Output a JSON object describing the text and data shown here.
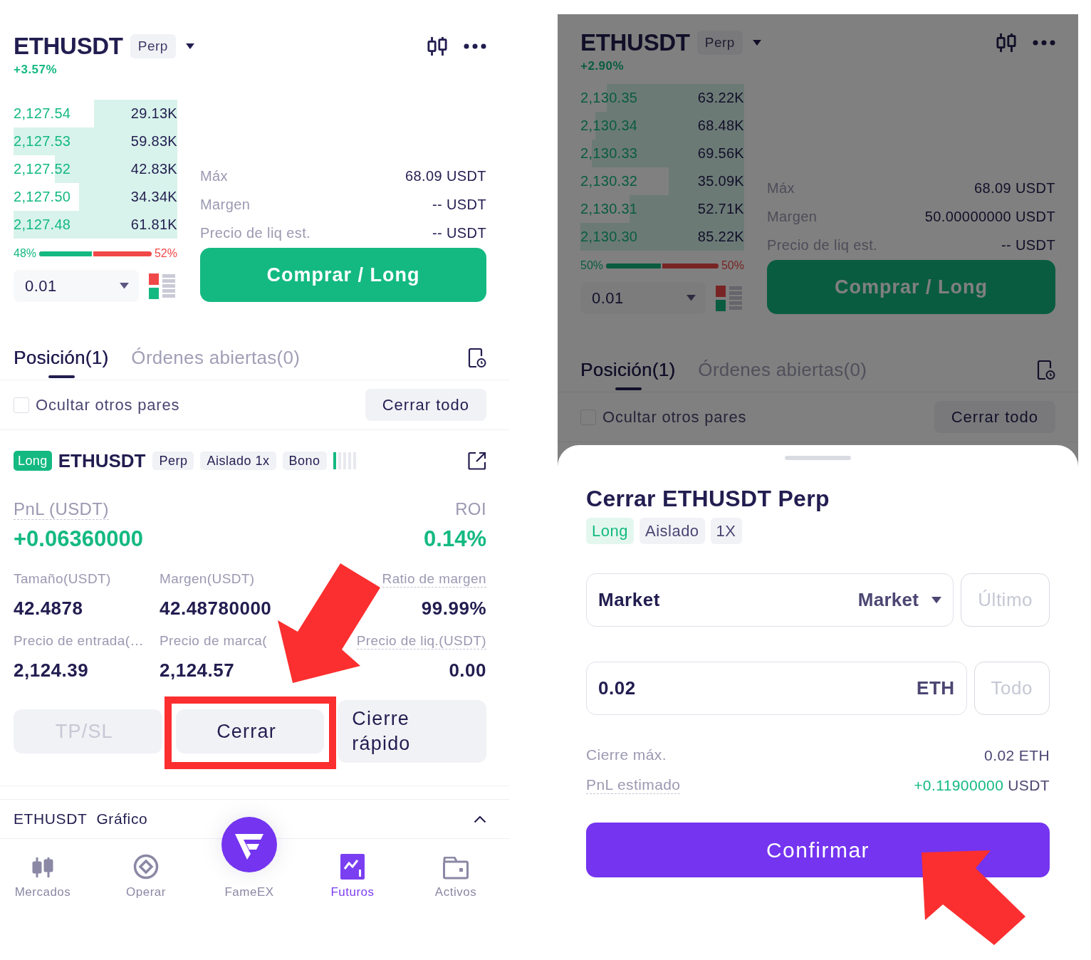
{
  "left_screen": {
    "header": {
      "symbol": "ETHUSDT",
      "chip": "Perp",
      "change": "+3.57%"
    },
    "order_book": [
      {
        "price": "2,127.54",
        "amount": "29.13K",
        "level": 0.51
      },
      {
        "price": "2,127.53",
        "amount": "59.83K",
        "level": 1
      },
      {
        "price": "2,127.52",
        "amount": "42.83K",
        "level": 0.75
      },
      {
        "price": "2,127.50",
        "amount": "34.34K",
        "level": 0.6
      },
      {
        "price": "2,127.48",
        "amount": "61.81K",
        "level": 1
      }
    ],
    "ratio": {
      "buy": "48%",
      "sell": "52%",
      "level": 0.48
    },
    "precision": "0.01",
    "stats": [
      {
        "label": "Máx",
        "value": "68.09 USDT"
      },
      {
        "label": "Margen",
        "value": "-- USDT"
      },
      {
        "label": "Precio de liq est.",
        "value": "-- USDT"
      }
    ],
    "buy_button": "Comprar / Long",
    "tabs": [
      {
        "label": "Posición(1)",
        "selected": true
      },
      {
        "label": "Órdenes abiertas(0)",
        "selected": false
      }
    ],
    "hide_pairs": {
      "label": "Ocultar otros pares",
      "checked": false
    },
    "close_all_button": "Cerrar todo",
    "position": {
      "side": {
        "label": "Long",
        "kind": "long"
      },
      "symbol": "ETHUSDT",
      "tags": [
        "Perp",
        "Aislado 1x",
        "Bono"
      ],
      "risk": {
        "level": 0.2
      },
      "pnl": {
        "label": "PnL (USDT)",
        "value": "+0.06360000",
        "hint": true,
        "positive": true
      },
      "roi": {
        "label": "ROI",
        "value": "0.14%",
        "hint": false,
        "positive": true
      },
      "metrics": [
        {
          "label": "Tamaño(USDT)",
          "value": "42.4878",
          "hint": false
        },
        {
          "label": "Margen(USDT)",
          "value": "42.48780000",
          "hint": false
        },
        {
          "label": "Ratio de margen",
          "value": "99.99%",
          "hint": true
        },
        {
          "label": "Precio de entrada(…",
          "value": "2,124.39",
          "hint": false
        },
        {
          "label": "Precio de marca(",
          "value": "2,124.57",
          "hint": false
        },
        {
          "label": "Precio de liq.(USDT)",
          "value": "0.00",
          "hint": true
        }
      ],
      "buttons": [
        {
          "label": "TP/SL",
          "disabled": true,
          "annotated": false
        },
        {
          "label": "Cerrar",
          "disabled": false,
          "annotated": true
        },
        {
          "label": "Cierre rápido",
          "disabled": false,
          "annotated": false
        }
      ]
    },
    "chart_toggle": {
      "symbol": "ETHUSDT",
      "label": "Gráfico"
    },
    "nav": [
      {
        "label": "Mercados",
        "kind": "markets",
        "selected": false
      },
      {
        "label": "Operar",
        "kind": "trade",
        "selected": false
      },
      {
        "label": "FameEX",
        "kind": "home",
        "selected": false
      },
      {
        "label": "Futuros",
        "kind": "futures",
        "selected": true
      },
      {
        "label": "Activos",
        "kind": "assets",
        "selected": false
      }
    ]
  },
  "right_screen": {
    "dimmed": true,
    "header": {
      "symbol": "ETHUSDT",
      "chip": "Perp",
      "change": "+2.90%"
    },
    "order_book": [
      {
        "price": "2,130.35",
        "amount": "63.22K",
        "level": 0.84
      },
      {
        "price": "2,130.34",
        "amount": "68.48K",
        "level": 0.91
      },
      {
        "price": "2,130.33",
        "amount": "69.56K",
        "level": 0.93
      },
      {
        "price": "2,130.32",
        "amount": "35.09K",
        "level": 0.46
      },
      {
        "price": "2,130.31",
        "amount": "52.71K",
        "level": 0.7
      },
      {
        "price": "2,130.30",
        "amount": "85.22K",
        "level": 1
      }
    ],
    "ratio": {
      "buy": "50%",
      "sell": "50%",
      "level": 0.5
    },
    "precision": "0.01",
    "stats": [
      {
        "label": "Máx",
        "value": "68.09 USDT"
      },
      {
        "label": "Margen",
        "value": "50.00000000 USDT"
      },
      {
        "label": "Precio de liq est.",
        "value": "-- USDT"
      }
    ],
    "buy_button": "Comprar / Long",
    "tabs": [
      {
        "label": "Posición(1)",
        "selected": true
      },
      {
        "label": "Órdenes abiertas(0)",
        "selected": false
      }
    ],
    "hide_pairs": {
      "label": "Ocultar otros pares",
      "checked": false
    },
    "close_all_button": "Cerrar todo",
    "close_sheet": {
      "title": "Cerrar ETHUSDT Perp",
      "tags": [
        {
          "label": "Long",
          "kind": "long"
        },
        {
          "label": "Aislado",
          "kind": "plain"
        },
        {
          "label": "1X",
          "kind": "plain"
        }
      ],
      "order_type": {
        "value": "Market",
        "selector": "Market"
      },
      "last_price_button": {
        "label": "Último",
        "disabled": true
      },
      "amount": {
        "value": "0.02",
        "unit": "ETH"
      },
      "all_button": {
        "label": "Todo",
        "disabled": true
      },
      "details": [
        {
          "label": "Cierre máx.",
          "value": "0.02 ETH",
          "hint": false
        },
        {
          "label": "PnL estimado",
          "value": "+0.11900000",
          "unit": "USDT",
          "hint": true,
          "positive": true
        }
      ],
      "confirm_button": {
        "label": "Confirmar",
        "annotated": true
      }
    }
  }
}
